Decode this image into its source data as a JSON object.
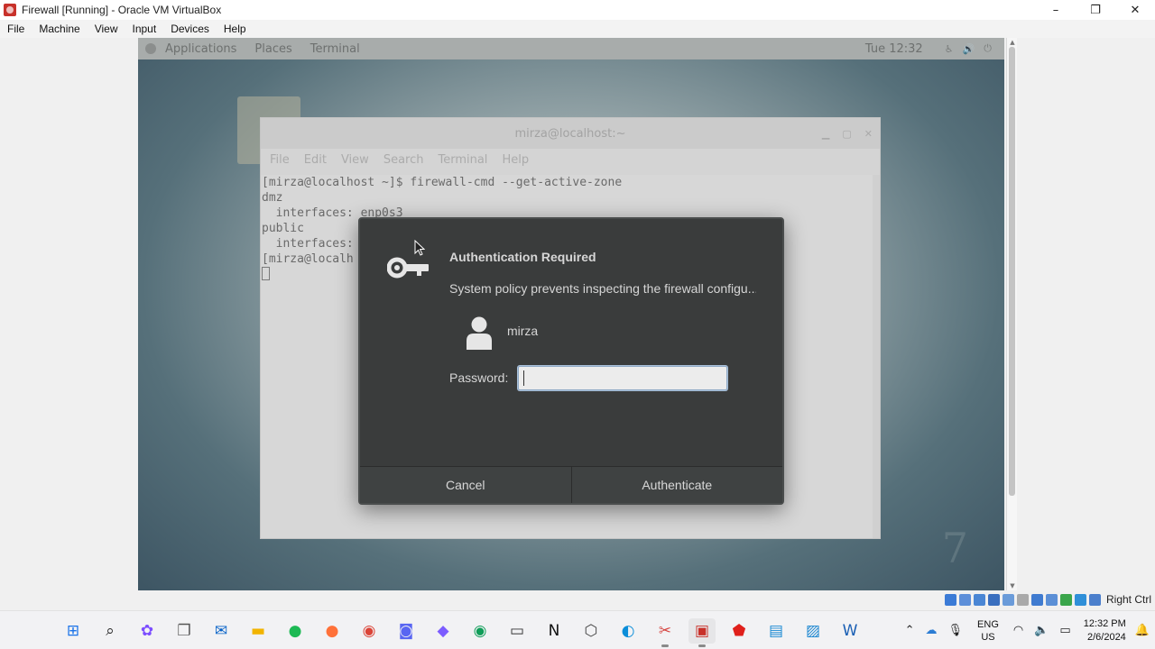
{
  "host_window": {
    "title": "Firewall [Running] - Oracle VM VirtualBox",
    "minimize": "–",
    "maximize": "❐",
    "close": "✕"
  },
  "host_menu": [
    "File",
    "Machine",
    "View",
    "Input",
    "Devices",
    "Help"
  ],
  "gnome_topbar": {
    "applications": "Applications",
    "places": "Places",
    "terminal": "Terminal",
    "clock": "Tue 12:32",
    "tray_accessibility_icon": "accessibility-icon",
    "tray_volume_icon": "volume-icon",
    "tray_power_icon": "power-icon"
  },
  "terminal": {
    "title": "mirza@localhost:~",
    "menu": [
      "File",
      "Edit",
      "View",
      "Search",
      "Terminal",
      "Help"
    ],
    "lines": [
      "[mirza@localhost ~]$ firewall-cmd --get-active-zone",
      "dmz",
      "  interfaces: enp0s3",
      "public",
      "  interfaces:",
      "[mirza@localh"
    ]
  },
  "auth_dialog": {
    "title": "Authentication Required",
    "message": "System policy prevents inspecting the firewall configu...",
    "user": "mirza",
    "password_label": "Password:",
    "password_value": "",
    "cancel": "Cancel",
    "authenticate": "Authenticate"
  },
  "vbox_status": {
    "host_key": "Right Ctrl"
  },
  "taskbar": {
    "apps": [
      {
        "name": "start-icon",
        "glyph": "⊞",
        "color": "#1a73e8"
      },
      {
        "name": "search-icon",
        "glyph": "⌕",
        "color": "#222222"
      },
      {
        "name": "copilot-icon",
        "glyph": "✿",
        "color": "#7c4dff"
      },
      {
        "name": "task-view-icon",
        "glyph": "❐",
        "color": "#555555"
      },
      {
        "name": "outlook-icon",
        "glyph": "✉",
        "color": "#0a64c8"
      },
      {
        "name": "file-explorer-icon",
        "glyph": "▬",
        "color": "#f2b400"
      },
      {
        "name": "spotify-icon",
        "glyph": "●",
        "color": "#1db954"
      },
      {
        "name": "firefox-icon",
        "glyph": "●",
        "color": "#ff7139"
      },
      {
        "name": "chrome-icon",
        "glyph": "◉",
        "color": "#db4437"
      },
      {
        "name": "discord-icon",
        "glyph": "◙",
        "color": "#5865f2"
      },
      {
        "name": "obsidian-icon",
        "glyph": "◆",
        "color": "#7c5cff"
      },
      {
        "name": "chrome-profile-icon",
        "glyph": "◉",
        "color": "#0f9d58"
      },
      {
        "name": "terminal-icon",
        "glyph": "▭",
        "color": "#333333"
      },
      {
        "name": "notion-icon",
        "glyph": "N",
        "color": "#111111"
      },
      {
        "name": "cube-app-icon",
        "glyph": "⬡",
        "color": "#444444"
      },
      {
        "name": "edge-icon",
        "glyph": "◐",
        "color": "#0c8ed9"
      },
      {
        "name": "snipping-tool-icon",
        "glyph": "✂",
        "color": "#d64541"
      },
      {
        "name": "virtualbox-icon",
        "glyph": "▣",
        "color": "#c8312a"
      },
      {
        "name": "acrobat-icon",
        "glyph": "⬟",
        "color": "#e0201b"
      },
      {
        "name": "notepad-icon",
        "glyph": "▤",
        "color": "#1b8ad3"
      },
      {
        "name": "photos-icon",
        "glyph": "▨",
        "color": "#1985d0"
      },
      {
        "name": "word-icon",
        "glyph": "W",
        "color": "#1a5fb4"
      }
    ],
    "tray": {
      "chevron_icon": "chevron-up-icon",
      "onedrive_icon": "cloud-icon",
      "mic_icon": "microphone-icon",
      "lang_top": "ENG",
      "lang_bottom": "US",
      "wifi_icon": "wifi-icon",
      "speaker_icon": "speaker-icon",
      "battery_icon": "battery-icon",
      "time": "12:32 PM",
      "date": "2/6/2024",
      "notification_icon": "notification-bell-icon"
    }
  }
}
